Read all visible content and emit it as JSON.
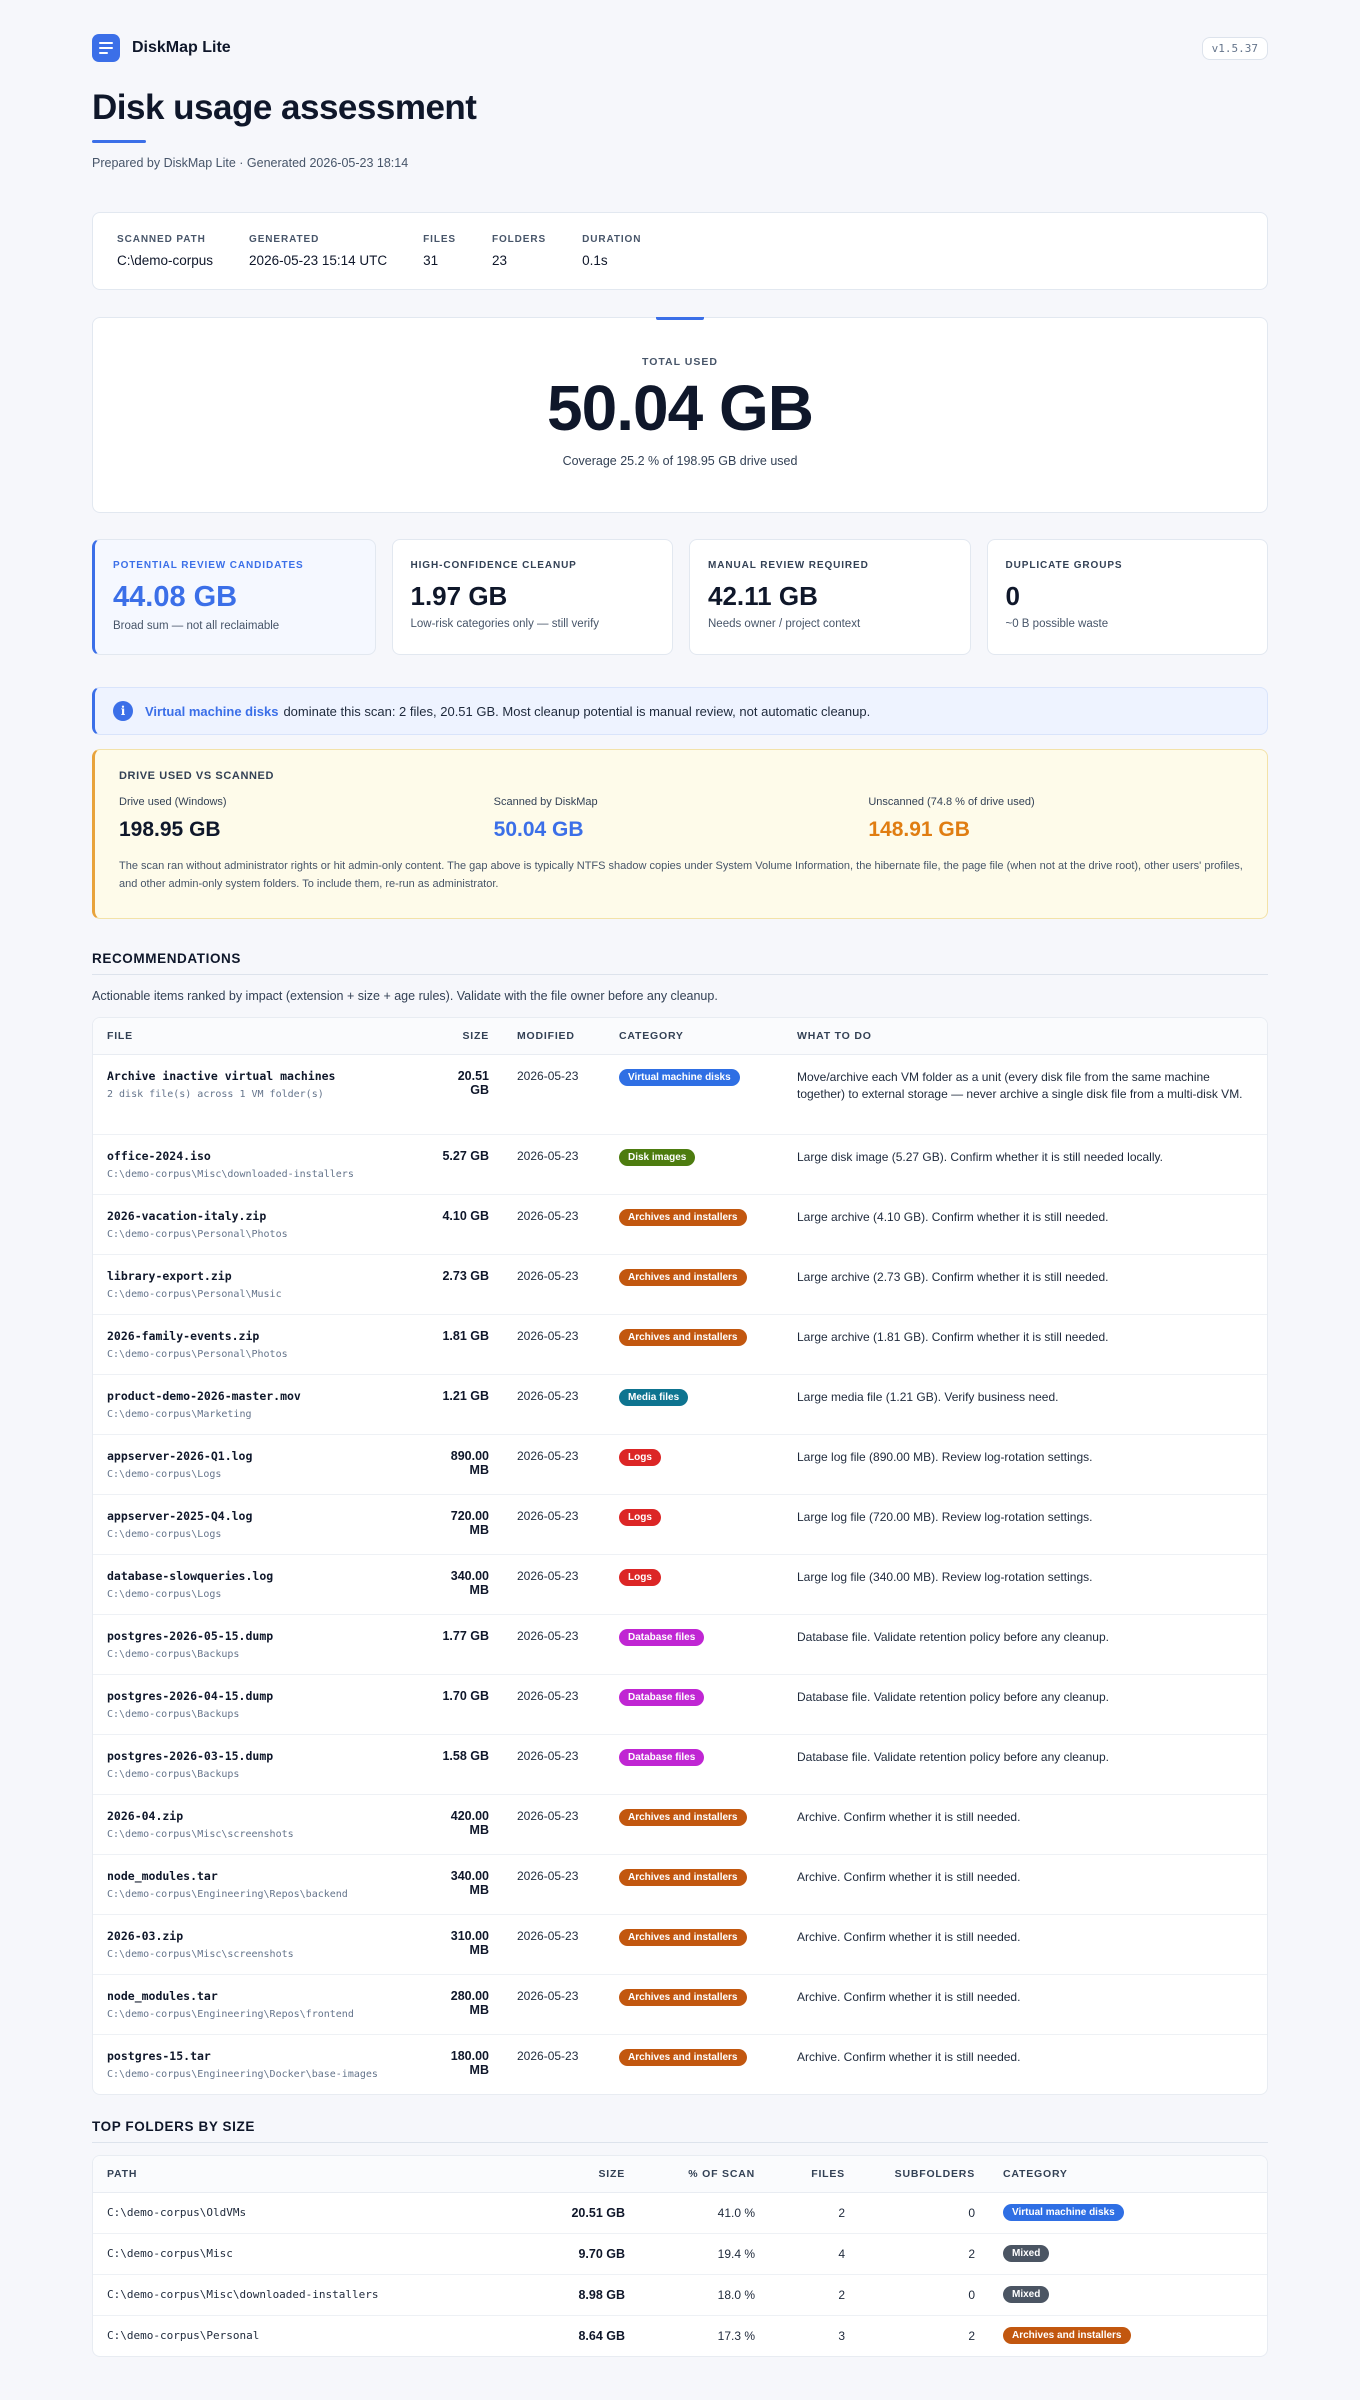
{
  "app": {
    "name": "DiskMap Lite",
    "version": "v1.5.37"
  },
  "report": {
    "title": "Disk usage assessment",
    "subtitle": "Prepared by DiskMap Lite · Generated 2026-05-23 18:14"
  },
  "scan_meta": [
    {
      "label": "SCANNED PATH",
      "value": "C:\\demo-corpus"
    },
    {
      "label": "GENERATED",
      "value": "2026-05-23 15:14 UTC"
    },
    {
      "label": "FILES",
      "value": "31"
    },
    {
      "label": "FOLDERS",
      "value": "23"
    },
    {
      "label": "DURATION",
      "value": "0.1s"
    }
  ],
  "total": {
    "label": "TOTAL USED",
    "value": "50.04 GB",
    "note": "Coverage 25.2 % of 198.95 GB drive used"
  },
  "stats": [
    {
      "label": "POTENTIAL REVIEW CANDIDATES",
      "value": "44.08 GB",
      "note": "Broad sum — not all reclaimable"
    },
    {
      "label": "HIGH-CONFIDENCE CLEANUP",
      "value": "1.97 GB",
      "note": "Low-risk categories only — still verify"
    },
    {
      "label": "MANUAL REVIEW REQUIRED",
      "value": "42.11 GB",
      "note": "Needs owner / project context"
    },
    {
      "label": "DUPLICATE GROUPS",
      "value": "0",
      "note": "~0 B possible waste"
    }
  ],
  "banner": {
    "icon": "info-icon",
    "highlight": "Virtual machine disks",
    "text": "dominate this scan: 2 files, 20.51 GB. Most cleanup potential is manual review, not automatic cleanup."
  },
  "drive": {
    "title": "DRIVE USED VS SCANNED",
    "columns": [
      {
        "label": "Drive used (Windows)",
        "value": "198.95 GB"
      },
      {
        "label": "Scanned by DiskMap",
        "value": "50.04 GB"
      },
      {
        "label": "Unscanned (74.8 % of drive used)",
        "value": "148.91 GB"
      }
    ],
    "note": "The scan ran without administrator rights or hit admin-only content. The gap above is typically NTFS shadow copies under System Volume Information, the hibernate file, the page file (when not at the drive root), other users' profiles, and other admin-only system folders. To include them, re-run as administrator."
  },
  "colors": {
    "accent": "#3b6fe8",
    "vm": "#2f6fe4",
    "disk_images": "#4d7c0f",
    "archives": "#c2570f",
    "media": "#0e7490",
    "logs": "#dc2626",
    "database": "#c026d3",
    "mixed": "#4b5563"
  },
  "recommendations": {
    "title": "RECOMMENDATIONS",
    "subtitle": "Actionable items ranked by impact (extension + size + age rules). Validate with the file owner before any cleanup.",
    "headers": {
      "file": "FILE",
      "size": "SIZE",
      "modified": "MODIFIED",
      "category": "CATEGORY",
      "todo": "WHAT TO DO"
    },
    "rows": [
      {
        "name": "Archive inactive virtual machines",
        "path": "2 disk file(s) across 1 VM folder(s)",
        "size": "20.51 GB",
        "modified": "2026-05-23",
        "category": "Virtual machine disks",
        "color": "vm",
        "todo": "Move/archive each VM folder as a unit (every disk file from the same machine together) to external storage — never archive a single disk file from a multi-disk VM."
      },
      {
        "name": "office-2024.iso",
        "path": "C:\\demo-corpus\\Misc\\downloaded-installers",
        "size": "5.27 GB",
        "modified": "2026-05-23",
        "category": "Disk images",
        "color": "disk_images",
        "todo": "Large disk image (5.27 GB). Confirm whether it is still needed locally."
      },
      {
        "name": "2026-vacation-italy.zip",
        "path": "C:\\demo-corpus\\Personal\\Photos",
        "size": "4.10 GB",
        "modified": "2026-05-23",
        "category": "Archives and installers",
        "color": "archives",
        "todo": "Large archive (4.10 GB). Confirm whether it is still needed."
      },
      {
        "name": "library-export.zip",
        "path": "C:\\demo-corpus\\Personal\\Music",
        "size": "2.73 GB",
        "modified": "2026-05-23",
        "category": "Archives and installers",
        "color": "archives",
        "todo": "Large archive (2.73 GB). Confirm whether it is still needed."
      },
      {
        "name": "2026-family-events.zip",
        "path": "C:\\demo-corpus\\Personal\\Photos",
        "size": "1.81 GB",
        "modified": "2026-05-23",
        "category": "Archives and installers",
        "color": "archives",
        "todo": "Large archive (1.81 GB). Confirm whether it is still needed."
      },
      {
        "name": "product-demo-2026-master.mov",
        "path": "C:\\demo-corpus\\Marketing",
        "size": "1.21 GB",
        "modified": "2026-05-23",
        "category": "Media files",
        "color": "media",
        "todo": "Large media file (1.21 GB). Verify business need."
      },
      {
        "name": "appserver-2026-Q1.log",
        "path": "C:\\demo-corpus\\Logs",
        "size": "890.00 MB",
        "modified": "2026-05-23",
        "category": "Logs",
        "color": "logs",
        "todo": "Large log file (890.00 MB). Review log-rotation settings."
      },
      {
        "name": "appserver-2025-Q4.log",
        "path": "C:\\demo-corpus\\Logs",
        "size": "720.00 MB",
        "modified": "2026-05-23",
        "category": "Logs",
        "color": "logs",
        "todo": "Large log file (720.00 MB). Review log-rotation settings."
      },
      {
        "name": "database-slowqueries.log",
        "path": "C:\\demo-corpus\\Logs",
        "size": "340.00 MB",
        "modified": "2026-05-23",
        "category": "Logs",
        "color": "logs",
        "todo": "Large log file (340.00 MB). Review log-rotation settings."
      },
      {
        "name": "postgres-2026-05-15.dump",
        "path": "C:\\demo-corpus\\Backups",
        "size": "1.77 GB",
        "modified": "2026-05-23",
        "category": "Database files",
        "color": "database",
        "todo": "Database file. Validate retention policy before any cleanup."
      },
      {
        "name": "postgres-2026-04-15.dump",
        "path": "C:\\demo-corpus\\Backups",
        "size": "1.70 GB",
        "modified": "2026-05-23",
        "category": "Database files",
        "color": "database",
        "todo": "Database file. Validate retention policy before any cleanup."
      },
      {
        "name": "postgres-2026-03-15.dump",
        "path": "C:\\demo-corpus\\Backups",
        "size": "1.58 GB",
        "modified": "2026-05-23",
        "category": "Database files",
        "color": "database",
        "todo": "Database file. Validate retention policy before any cleanup."
      },
      {
        "name": "2026-04.zip",
        "path": "C:\\demo-corpus\\Misc\\screenshots",
        "size": "420.00 MB",
        "modified": "2026-05-23",
        "category": "Archives and installers",
        "color": "archives",
        "todo": "Archive. Confirm whether it is still needed."
      },
      {
        "name": "node_modules.tar",
        "path": "C:\\demo-corpus\\Engineering\\Repos\\backend",
        "size": "340.00 MB",
        "modified": "2026-05-23",
        "category": "Archives and installers",
        "color": "archives",
        "todo": "Archive. Confirm whether it is still needed."
      },
      {
        "name": "2026-03.zip",
        "path": "C:\\demo-corpus\\Misc\\screenshots",
        "size": "310.00 MB",
        "modified": "2026-05-23",
        "category": "Archives and installers",
        "color": "archives",
        "todo": "Archive. Confirm whether it is still needed."
      },
      {
        "name": "node_modules.tar",
        "path": "C:\\demo-corpus\\Engineering\\Repos\\frontend",
        "size": "280.00 MB",
        "modified": "2026-05-23",
        "category": "Archives and installers",
        "color": "archives",
        "todo": "Archive. Confirm whether it is still needed."
      },
      {
        "name": "postgres-15.tar",
        "path": "C:\\demo-corpus\\Engineering\\Docker\\base-images",
        "size": "180.00 MB",
        "modified": "2026-05-23",
        "category": "Archives and installers",
        "color": "archives",
        "todo": "Archive. Confirm whether it is still needed."
      }
    ]
  },
  "top_folders": {
    "title": "TOP FOLDERS BY SIZE",
    "headers": {
      "path": "PATH",
      "size": "SIZE",
      "pct": "% OF SCAN",
      "files": "FILES",
      "subfolders": "SUBFOLDERS",
      "category": "CATEGORY"
    },
    "rows": [
      {
        "path": "C:\\demo-corpus\\OldVMs",
        "size": "20.51 GB",
        "pct": "41.0 %",
        "files": "2",
        "subfolders": "0",
        "category": "Virtual machine disks",
        "color": "vm"
      },
      {
        "path": "C:\\demo-corpus\\Misc",
        "size": "9.70 GB",
        "pct": "19.4 %",
        "files": "4",
        "subfolders": "2",
        "category": "Mixed",
        "color": "mixed"
      },
      {
        "path": "C:\\demo-corpus\\Misc\\downloaded-installers",
        "size": "8.98 GB",
        "pct": "18.0 %",
        "files": "2",
        "subfolders": "0",
        "category": "Mixed",
        "color": "mixed"
      },
      {
        "path": "C:\\demo-corpus\\Personal",
        "size": "8.64 GB",
        "pct": "17.3 %",
        "files": "3",
        "subfolders": "2",
        "category": "Archives and installers",
        "color": "archives"
      }
    ]
  }
}
